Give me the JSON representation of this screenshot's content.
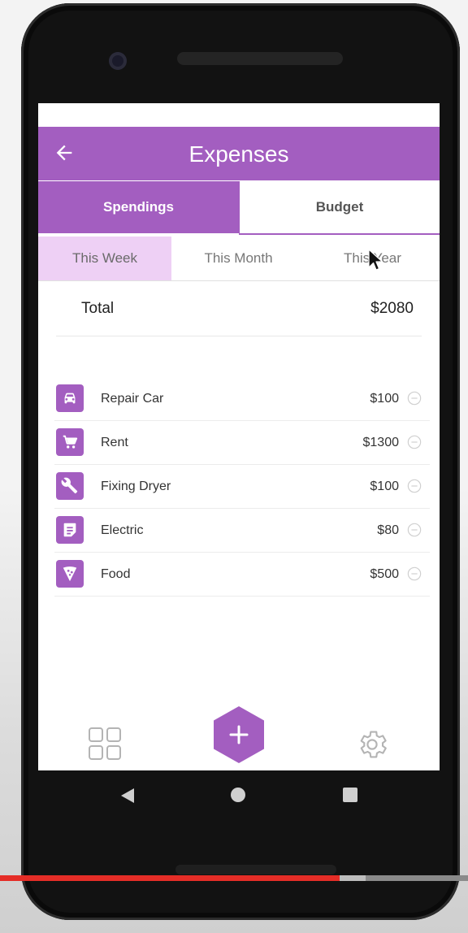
{
  "appbar": {
    "title": "Expenses",
    "back_icon": "arrow-left-icon"
  },
  "tabs": {
    "spendings": "Spendings",
    "budget": "Budget",
    "active": "Spendings"
  },
  "period": {
    "week": "This Week",
    "month": "This Month",
    "year": "This Year",
    "active": "This Week"
  },
  "total": {
    "label": "Total",
    "value": "$2080"
  },
  "expenses": [
    {
      "name": "Repair Car",
      "amount": "$100",
      "icon": "car-icon"
    },
    {
      "name": "Rent",
      "amount": "$1300",
      "icon": "cart-icon"
    },
    {
      "name": "Fixing Dryer",
      "amount": "$100",
      "icon": "wrench-icon"
    },
    {
      "name": "Electric",
      "amount": "$80",
      "icon": "document-icon"
    },
    {
      "name": "Food",
      "amount": "$500",
      "icon": "pizza-icon"
    }
  ],
  "bottom_nav": {
    "left_icon": "grid-icon",
    "center_icon": "plus-hexagon-icon",
    "right_icon": "gear-icon"
  },
  "colors": {
    "primary": "#a35ec0",
    "active_period_bg": "#eed0f5",
    "progress": "#e52d27"
  },
  "video_progress": 0.726
}
